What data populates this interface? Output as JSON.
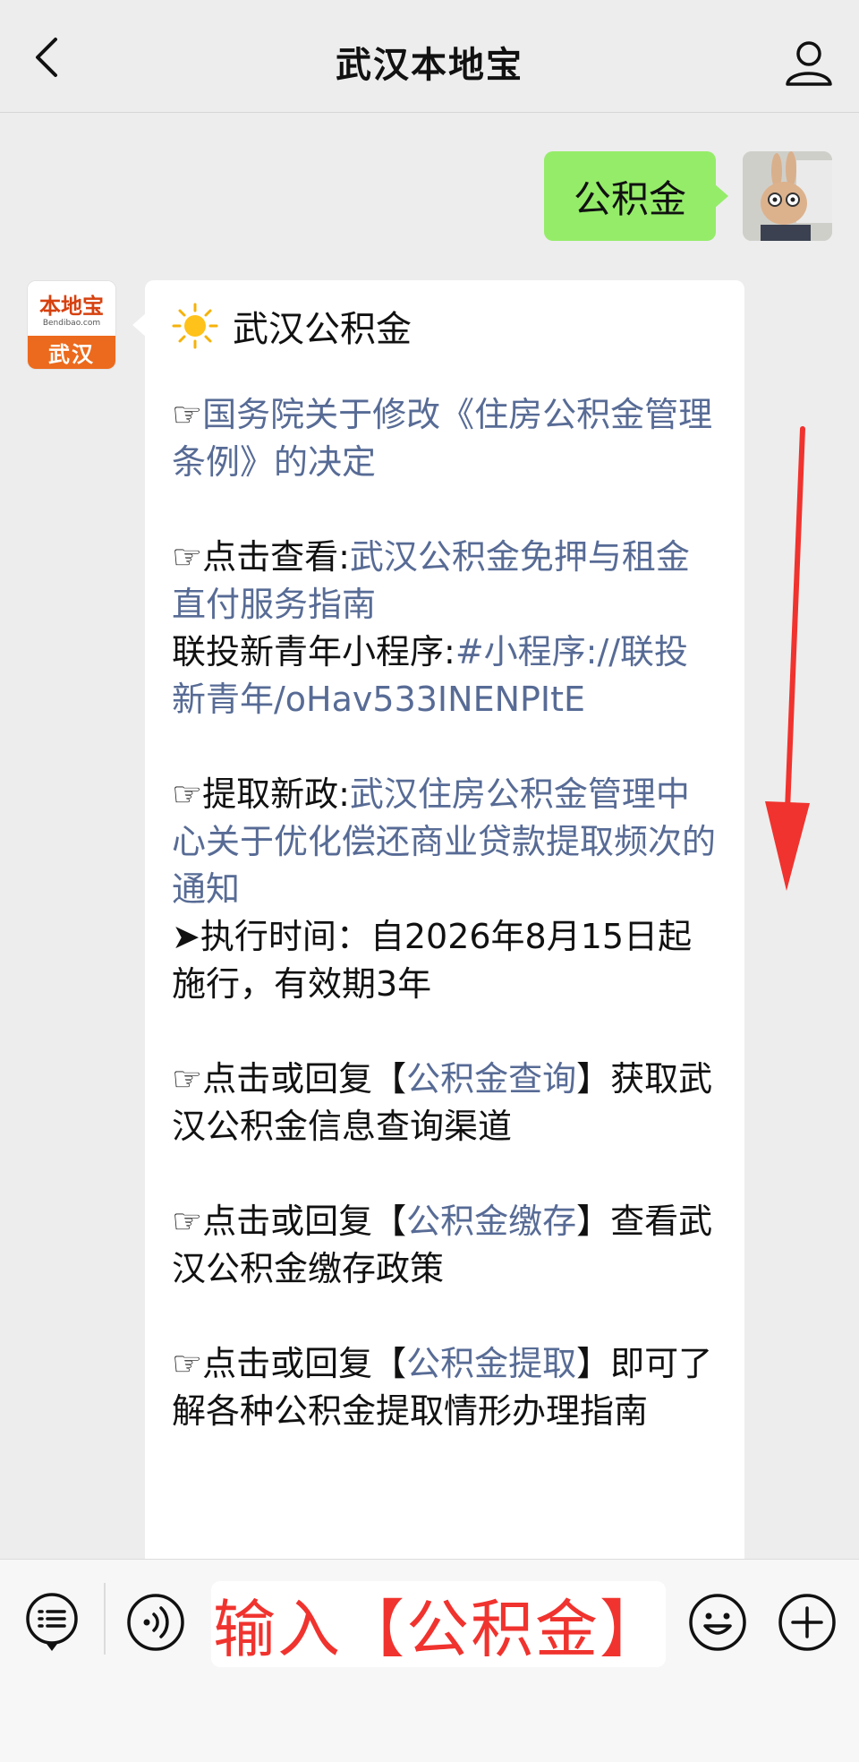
{
  "header": {
    "title": "武汉本地宝"
  },
  "user_message": {
    "text": "公积金"
  },
  "bot_avatar": {
    "logo_text": "本地宝",
    "domain_text": "Bendibao.com",
    "city_label": "武汉"
  },
  "bot_message": {
    "heading": "武汉公积金",
    "blocks": [
      {
        "prefix": "☞",
        "link": "国务院关于修改《住房公积金管理条例》的决定"
      },
      {
        "prefix": "☞点击查看:",
        "link": "武汉公积金免押与租金直付服务指南",
        "line2_text": "联投新青年小程序:",
        "line2_link": "#小程序://联投新青年/oHav533INENPItE"
      },
      {
        "prefix": "☞提取新政:",
        "link": "武汉住房公积金管理中心关于优化偿还商业贷款提取频次的通知",
        "note": "➤执行时间：自2026年8月15日起施行，有效期3年"
      },
      {
        "prefix": "☞点击或回复【",
        "link": "公积金查询",
        "suffix": "】获取武汉公积金信息查询渠道"
      },
      {
        "prefix": "☞点击或回复【",
        "link": "公积金缴存",
        "suffix": "】查看武汉公积金缴存政策"
      },
      {
        "prefix": "☞点击或回复【",
        "link": "公积金提取",
        "suffix": "】即可了解各种公积金提取情形办理指南"
      }
    ]
  },
  "input_bar": {
    "input_text": "输入【公积金】"
  },
  "colors": {
    "link": "#576b95",
    "user_bubble": "#95ec69",
    "annotation": "#f0332e",
    "brand": "#ec6a1d"
  },
  "icons": [
    "back-arrow-icon",
    "profile-icon",
    "sun-icon",
    "menu-icon",
    "voice-icon",
    "emoji-icon",
    "plus-icon"
  ]
}
